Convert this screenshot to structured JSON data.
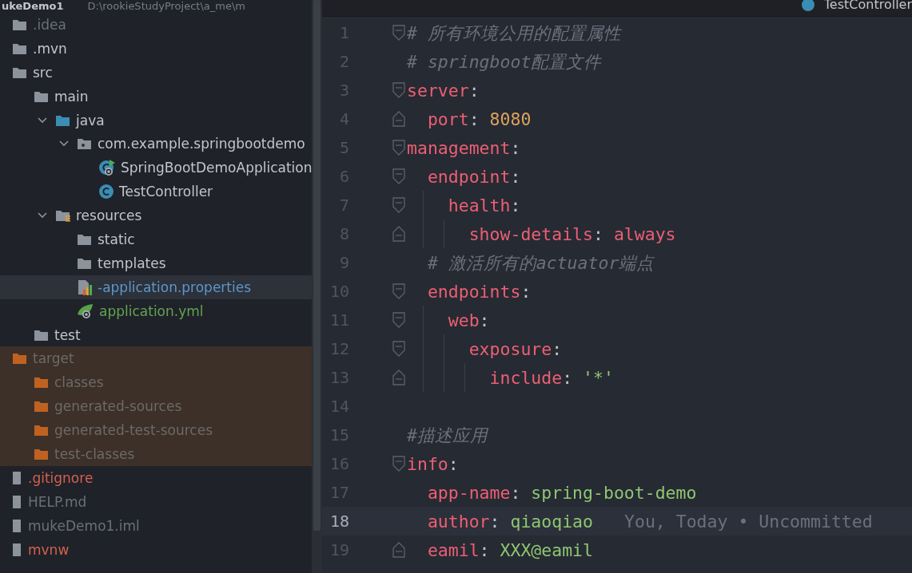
{
  "project_header": {
    "name": "ukeDemo1",
    "path": "D:\\rookieStudyProject\\a_me\\m"
  },
  "tree": [
    {
      "name": ".idea",
      "kind": "folder",
      "color": "#697079",
      "excluded": false
    },
    {
      "name": ".mvn",
      "kind": "folder",
      "color": "#c2c5ca",
      "excluded": false
    },
    {
      "name": "src",
      "kind": "folder",
      "color": "#c2c5ca",
      "excluded": false,
      "children": [
        {
          "name": "main",
          "kind": "folder",
          "color": "#c2c5ca",
          "excluded": false,
          "children": [
            {
              "name": "java",
              "kind": "source",
              "color": "#c2c5ca",
              "excluded": false,
              "expanded": true,
              "children": [
                {
                  "name": "com.example.springbootdemo",
                  "kind": "package",
                  "color": "#c2c5ca",
                  "excluded": false,
                  "expanded": true,
                  "children": [
                    {
                      "name": "SpringBootDemoApplication",
                      "kind": "application",
                      "color": "#c2c5ca",
                      "excluded": false
                    },
                    {
                      "name": "TestController",
                      "kind": "class",
                      "color": "#c2c5ca",
                      "excluded": false
                    }
                  ]
                }
              ]
            },
            {
              "name": "resources",
              "kind": "resources",
              "color": "#c2c5ca",
              "excluded": false,
              "expanded": true,
              "children": [
                {
                  "name": "static",
                  "kind": "folder",
                  "color": "#c2c5ca",
                  "excluded": false
                },
                {
                  "name": "templates",
                  "kind": "folder",
                  "color": "#c2c5ca",
                  "excluded": false
                },
                {
                  "name": "-application.properties",
                  "kind": "properties",
                  "color": "#5f96c9",
                  "excluded": false,
                  "selected": true
                },
                {
                  "name": "application.yml",
                  "kind": "yaml",
                  "color": "#62a352",
                  "excluded": false,
                  "selected": false
                }
              ]
            }
          ]
        },
        {
          "name": "test",
          "kind": "folder",
          "color": "#c2c5ca",
          "excluded": false
        }
      ]
    },
    {
      "name": "target",
      "kind": "folder",
      "color": "#6d6a66",
      "excluded": true,
      "children": [
        {
          "name": "classes",
          "kind": "folder",
          "color": "#6d6a66",
          "excluded": true
        },
        {
          "name": "generated-sources",
          "kind": "folder",
          "color": "#6d6a66",
          "excluded": true
        },
        {
          "name": "generated-test-sources",
          "kind": "folder",
          "color": "#6d6a66",
          "excluded": true
        },
        {
          "name": "test-classes",
          "kind": "folder",
          "color": "#6d6a66",
          "excluded": true
        }
      ]
    },
    {
      "name": ".gitignore",
      "kind": "file",
      "color": "#d4604f",
      "excluded": false
    },
    {
      "name": "HELP.md",
      "kind": "file",
      "color": "#697079",
      "excluded": false
    },
    {
      "name": "mukeDemo1.iml",
      "kind": "file",
      "color": "#697079",
      "excluded": false
    },
    {
      "name": "mvnw",
      "kind": "file",
      "color": "#d4604f",
      "excluded": false
    }
  ],
  "editor_tab": {
    "title": "TestController"
  },
  "lines": [
    {
      "number": "1",
      "kind": "opener",
      "tokens": [
        {
          "kind": "comment",
          "text": "# 所有环境公用的配置属性"
        }
      ]
    },
    {
      "number": "2",
      "kind": "plain",
      "tokens": [
        {
          "kind": "comment",
          "text": "# springboot配置文件"
        }
      ]
    },
    {
      "number": "3",
      "kind": "opener",
      "tokens": [
        {
          "kind": "key",
          "text": "server"
        },
        {
          "kind": "punct",
          "text": ":"
        }
      ]
    },
    {
      "number": "4",
      "kind": "closer",
      "tokens": [
        {
          "kind": "key",
          "text": "  port"
        },
        {
          "kind": "punct",
          "text": ": "
        },
        {
          "kind": "number",
          "text": "8080"
        }
      ]
    },
    {
      "number": "5",
      "kind": "opener",
      "tokens": [
        {
          "kind": "key",
          "text": "management"
        },
        {
          "kind": "punct",
          "text": ":"
        }
      ]
    },
    {
      "number": "6",
      "kind": "opener",
      "tokens": [
        {
          "kind": "key",
          "text": "  endpoint"
        },
        {
          "kind": "punct",
          "text": ":"
        }
      ]
    },
    {
      "number": "7",
      "kind": "opener",
      "tokens": [
        {
          "kind": "key",
          "text": "    health"
        },
        {
          "kind": "punct",
          "text": ":"
        }
      ]
    },
    {
      "number": "8",
      "kind": "closer",
      "tokens": [
        {
          "kind": "key",
          "text": "      show-details"
        },
        {
          "kind": "punct",
          "text": ": "
        },
        {
          "kind": "string",
          "text": "always"
        }
      ]
    },
    {
      "number": "9",
      "kind": "plain",
      "tokens": [
        {
          "kind": "comment",
          "text": "  # 激活所有的actuator端点"
        }
      ]
    },
    {
      "number": "10",
      "kind": "opener",
      "tokens": [
        {
          "kind": "key",
          "text": "  endpoints"
        },
        {
          "kind": "punct",
          "text": ":"
        }
      ]
    },
    {
      "number": "11",
      "kind": "opener",
      "tokens": [
        {
          "kind": "key",
          "text": "    web"
        },
        {
          "kind": "punct",
          "text": ":"
        }
      ]
    },
    {
      "number": "12",
      "kind": "opener",
      "tokens": [
        {
          "kind": "key",
          "text": "      exposure"
        },
        {
          "kind": "punct",
          "text": ":"
        }
      ]
    },
    {
      "number": "13",
      "kind": "closer",
      "tokens": [
        {
          "kind": "key",
          "text": "        include"
        },
        {
          "kind": "punct",
          "text": ": "
        },
        {
          "kind": "value",
          "text": "'*'"
        }
      ]
    },
    {
      "number": "14",
      "kind": "plain"
    },
    {
      "number": "15",
      "kind": "plain",
      "tokens": [
        {
          "kind": "comment",
          "text": "#描述应用"
        }
      ]
    },
    {
      "number": "16",
      "kind": "opener",
      "tokens": [
        {
          "kind": "key",
          "text": "info"
        },
        {
          "kind": "punct",
          "text": ":"
        }
      ]
    },
    {
      "number": "17",
      "kind": "plain",
      "tokens": [
        {
          "kind": "key",
          "text": "  app-name"
        },
        {
          "kind": "punct",
          "text": ": "
        },
        {
          "kind": "value",
          "text": "spring-boot-demo"
        }
      ]
    },
    {
      "number": "18",
      "kind": "plain",
      "current": true,
      "tokens": [
        {
          "kind": "key",
          "text": "  author"
        },
        {
          "kind": "punct",
          "text": ": "
        },
        {
          "kind": "value",
          "text": "qiaoqiao"
        }
      ],
      "blame": "You, Today • Uncommitted"
    },
    {
      "number": "19",
      "kind": "closer",
      "tokens": [
        {
          "kind": "key",
          "text": "  eamil"
        },
        {
          "kind": "punct",
          "text": ": "
        },
        {
          "kind": "value",
          "text": "XXX@eamil"
        }
      ]
    }
  ]
}
